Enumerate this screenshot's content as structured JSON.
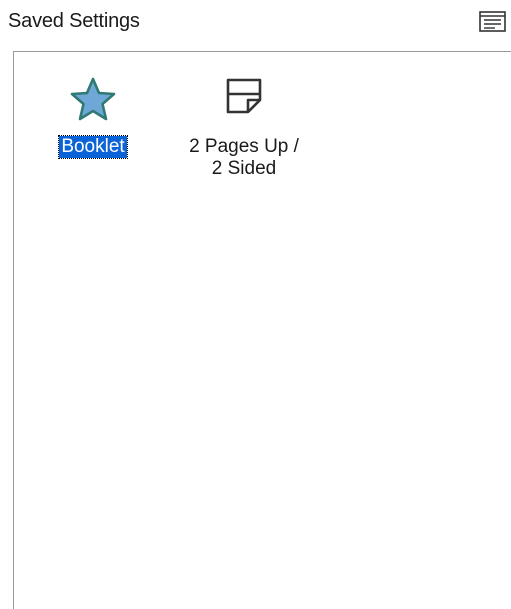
{
  "header": {
    "title": "Saved Settings",
    "view_button_icon": "view-options-icon"
  },
  "items": [
    {
      "label": "Booklet",
      "icon": "star-icon",
      "selected": true,
      "icon_color": "#6fa8d6"
    },
    {
      "label_lines": [
        "2 Pages Up /",
        "2 Sided"
      ],
      "icon": "page-icon",
      "selected": false
    }
  ],
  "colors": {
    "selection": "#0a64d8",
    "border": "#9a9a9a",
    "star_outline": "#2f7a73"
  }
}
